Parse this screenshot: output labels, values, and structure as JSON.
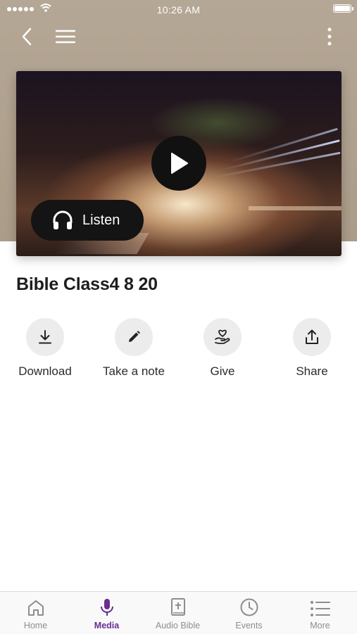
{
  "status_bar": {
    "time": "10:26 AM"
  },
  "media": {
    "title": "Bible Class4 8 20",
    "listen_label": "Listen"
  },
  "actions": [
    {
      "label": "Download",
      "icon": "download-icon"
    },
    {
      "label": "Take a note",
      "icon": "pencil-icon"
    },
    {
      "label": "Give",
      "icon": "give-heart-hand-icon"
    },
    {
      "label": "Share",
      "icon": "share-icon"
    }
  ],
  "tabs": [
    {
      "label": "Home",
      "icon": "home-icon",
      "active": false
    },
    {
      "label": "Media",
      "icon": "microphone-icon",
      "active": true
    },
    {
      "label": "Audio Bible",
      "icon": "bible-icon",
      "active": false
    },
    {
      "label": "Events",
      "icon": "clock-icon",
      "active": false
    },
    {
      "label": "More",
      "icon": "list-icon",
      "active": false
    }
  ],
  "colors": {
    "accent": "#6a2c91",
    "header_bg": "#b0a18f",
    "inactive_tab": "#8d8d8d"
  }
}
